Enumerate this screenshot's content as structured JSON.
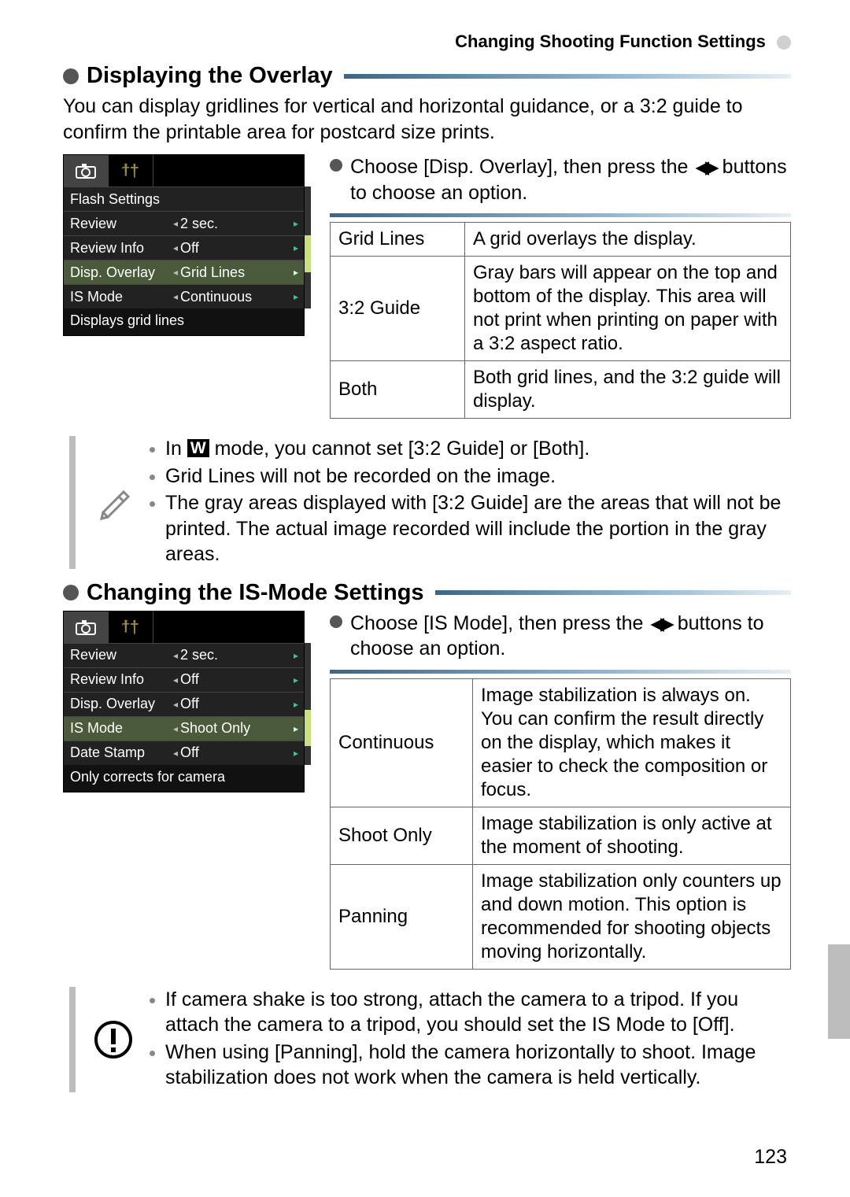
{
  "header": "Changing Shooting Function Settings",
  "page_number": "123",
  "section1": {
    "title": "Displaying the Overlay",
    "intro": "You can display gridlines for vertical and horizontal guidance, or a 3:2 guide to confirm the printable area for postcard size prints.",
    "instruction_pre": "Choose [Disp. Overlay], then press the",
    "instruction_post": "buttons to choose an option.",
    "menu": {
      "header_row": "Flash Settings",
      "rows": [
        {
          "label": "Review",
          "value": "2 sec."
        },
        {
          "label": "Review Info",
          "value": "Off"
        },
        {
          "label": "Disp. Overlay",
          "value": "Grid Lines"
        },
        {
          "label": "IS Mode",
          "value": "Continuous"
        }
      ],
      "footer": "Displays grid lines"
    },
    "table": [
      {
        "term": "Grid Lines",
        "desc": "A grid overlays the display."
      },
      {
        "term": "3:2 Guide",
        "desc": "Gray bars will appear on the top and bottom of the display. This area will not print when printing on paper with a 3:2 aspect ratio."
      },
      {
        "term": "Both",
        "desc": "Both grid lines, and the 3:2 guide will display."
      }
    ],
    "notes": {
      "n1_pre": "In",
      "n1_post": "mode, you cannot set [3:2 Guide] or [Both].",
      "n2": "Grid Lines will not be recorded on the image.",
      "n3": "The gray areas displayed with [3:2 Guide] are the areas that will not be printed. The actual image recorded will include the portion in the gray areas."
    }
  },
  "section2": {
    "title": "Changing the IS-Mode Settings",
    "instruction_pre": "Choose [IS Mode], then press the",
    "instruction_post": "buttons to choose an option.",
    "menu": {
      "rows": [
        {
          "label": "Review",
          "value": "2 sec."
        },
        {
          "label": "Review Info",
          "value": "Off"
        },
        {
          "label": "Disp. Overlay",
          "value": "Off"
        },
        {
          "label": "IS Mode",
          "value": "Shoot Only"
        },
        {
          "label": "Date Stamp",
          "value": "Off"
        }
      ],
      "footer": "Only corrects for camera"
    },
    "table": [
      {
        "term": "Continuous",
        "desc": "Image stabilization is always on. You can confirm the result directly on the display, which makes it easier to check the composition or focus."
      },
      {
        "term": "Shoot Only",
        "desc": "Image stabilization is only active at the moment of shooting."
      },
      {
        "term": "Panning",
        "desc": "Image stabilization only counters up and down motion. This option is recommended for shooting objects moving horizontally."
      }
    ],
    "notes": {
      "n1": "If camera shake is too strong, attach the camera to a tripod. If you attach the camera to a tripod, you should set the IS Mode to [Off].",
      "n2": "When using [Panning], hold the camera horizontally to shoot. Image stabilization does not work when the camera is held vertically."
    }
  },
  "icons": {
    "w_label": "W"
  }
}
